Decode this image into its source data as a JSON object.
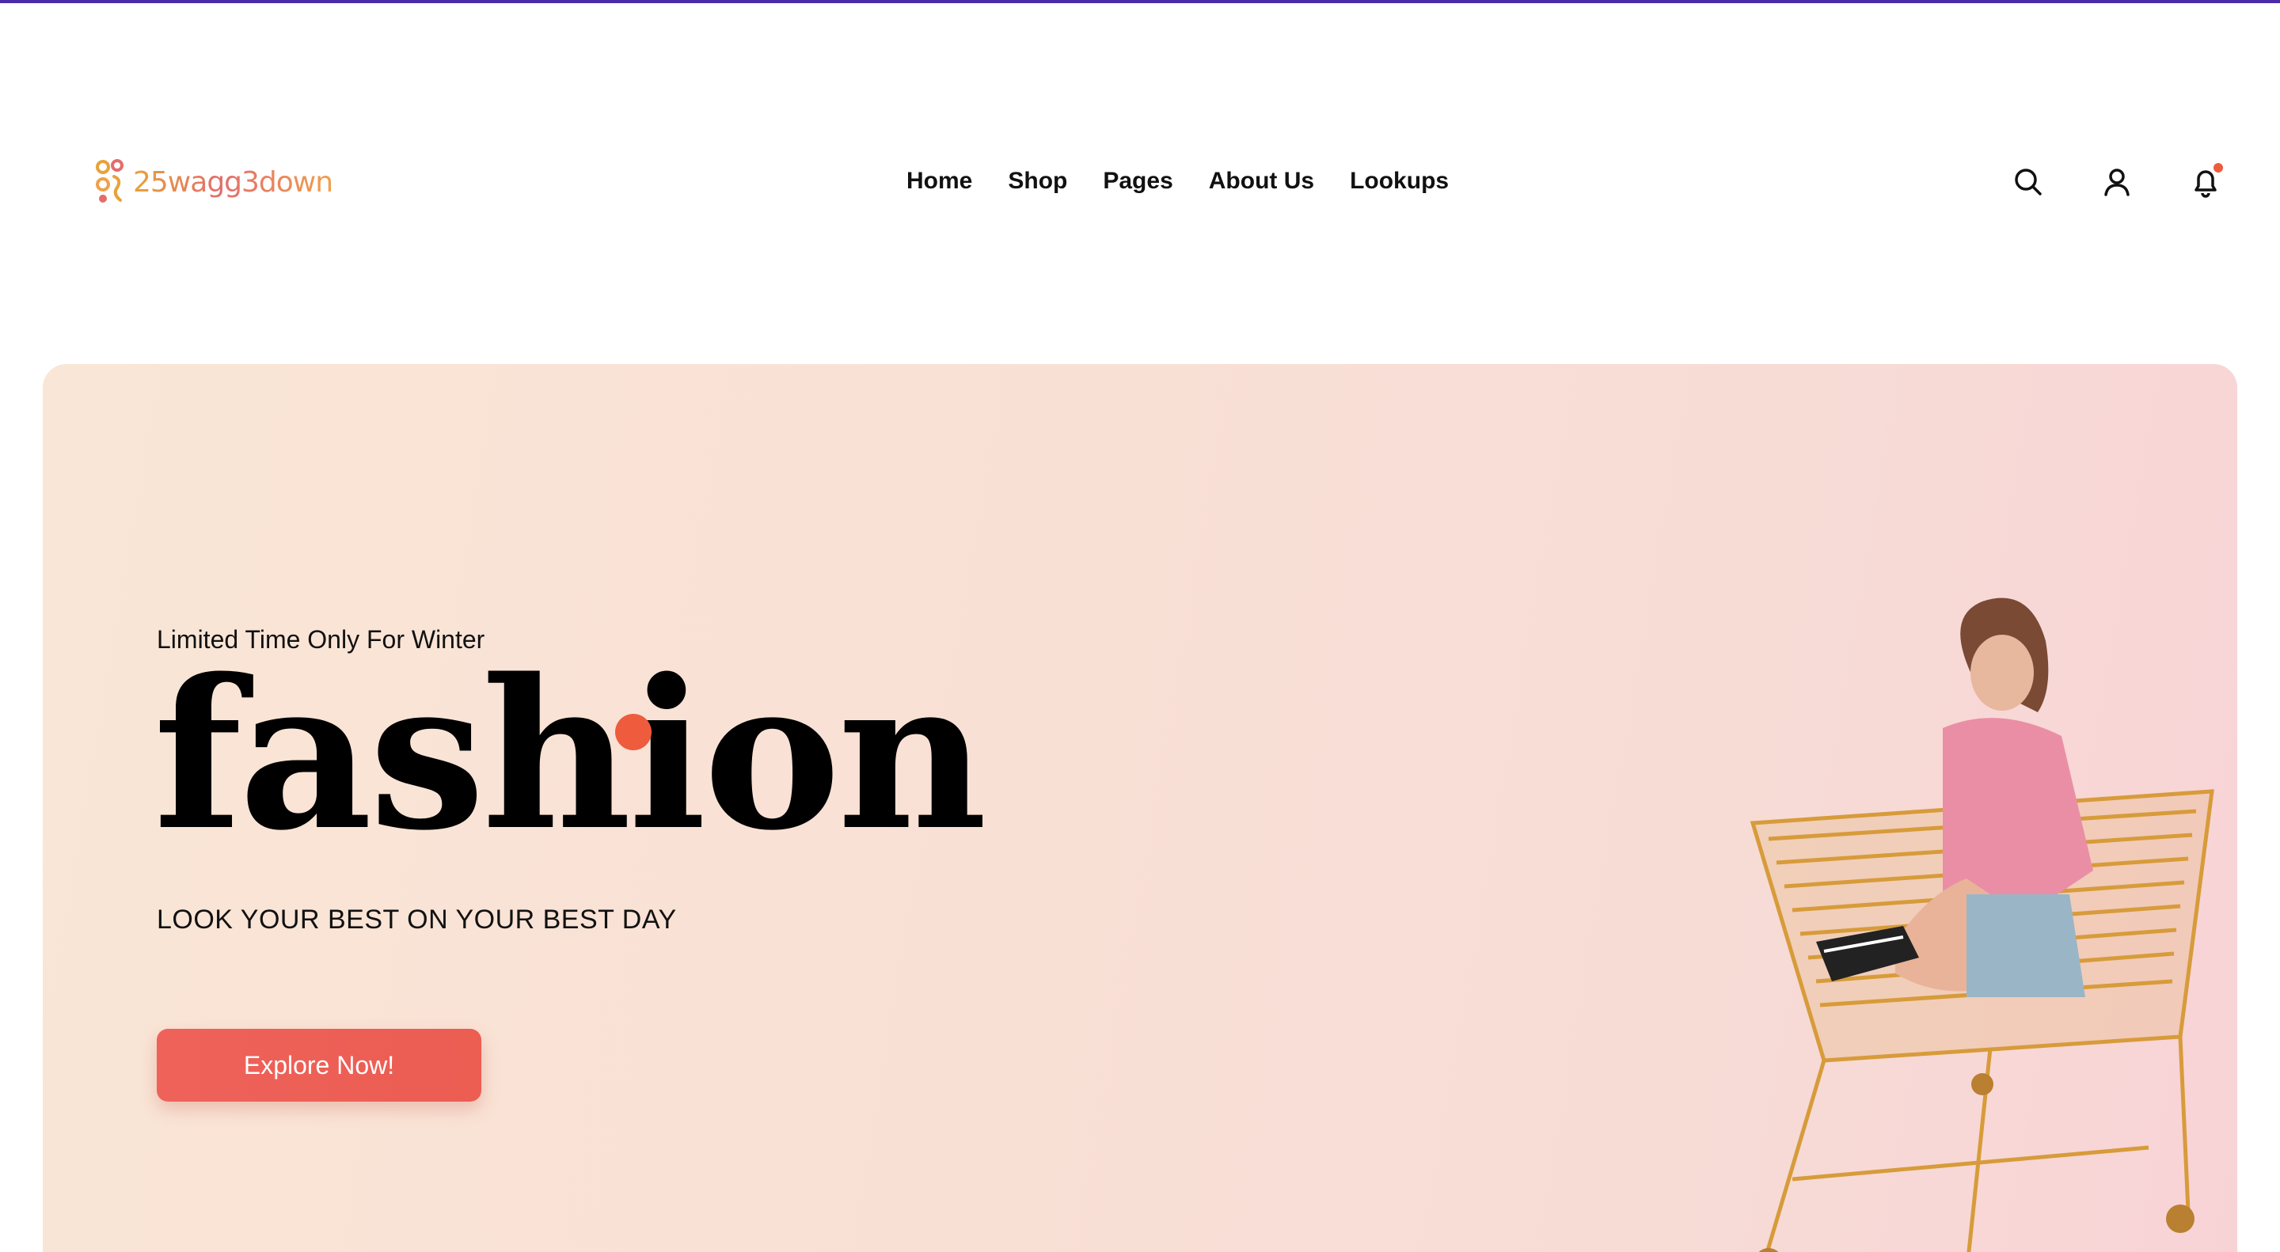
{
  "brand": {
    "logo_text": "25wagg3down"
  },
  "nav": {
    "items": [
      {
        "label": "Home"
      },
      {
        "label": "Shop"
      },
      {
        "label": "Pages"
      },
      {
        "label": "About Us"
      },
      {
        "label": "Lookups"
      }
    ]
  },
  "header_icons": {
    "search": "search-icon",
    "account": "user-icon",
    "notifications": "bell-icon",
    "notification_badge_color": "#ee5b3d"
  },
  "hero": {
    "eyebrow": "Limited Time Only For Winter",
    "headline": "fashion",
    "tagline": "LOOK YOUR BEST ON YOUR BEST DAY",
    "cta_label": "Explore Now!",
    "accent_color": "#ee5b3d",
    "image_alt": "woman-sitting-in-shopping-cart"
  },
  "colors": {
    "top_line": "#4b2aa8",
    "cta": "#ee625a",
    "hero_bg_start": "#f9e6d6",
    "hero_bg_end": "#f8d3d6"
  }
}
